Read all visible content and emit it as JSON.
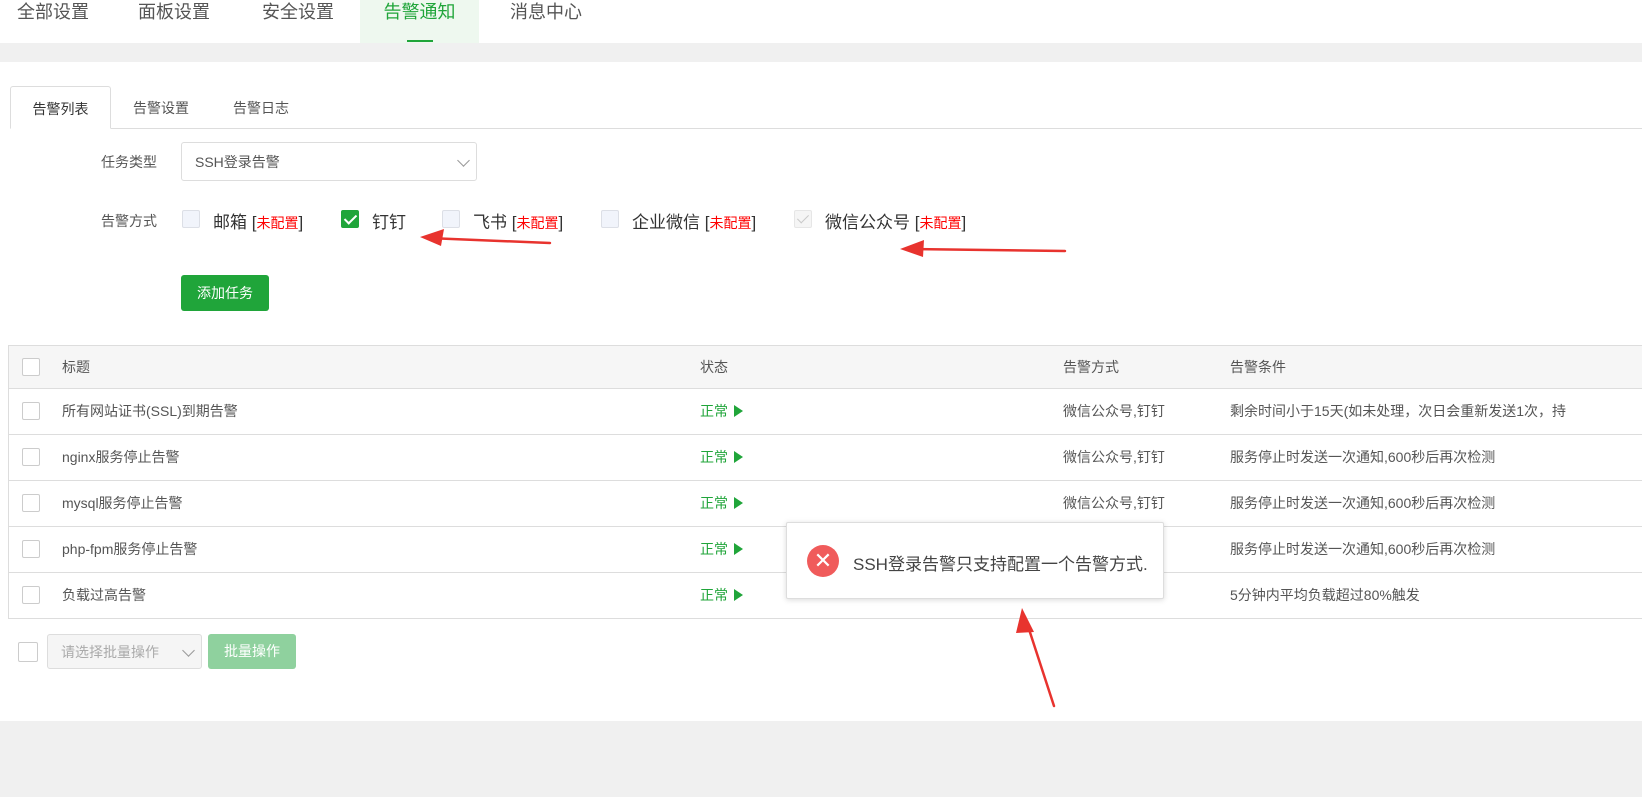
{
  "top_tabs": [
    "全部设置",
    "面板设置",
    "安全设置",
    "告警通知",
    "消息中心"
  ],
  "sub_tabs": [
    "告警列表",
    "告警设置",
    "告警日志"
  ],
  "form": {
    "task_type_label": "任务类型",
    "task_type_value": "SSH登录告警",
    "method_label": "告警方式",
    "methods": [
      {
        "name": "邮箱",
        "checked": false,
        "not_configured": "未配置"
      },
      {
        "name": "钉钉",
        "checked": true,
        "not_configured": ""
      },
      {
        "name": "飞书",
        "checked": false,
        "not_configured": "未配置"
      },
      {
        "name": "企业微信",
        "checked": false,
        "not_configured": "未配置"
      },
      {
        "name": "微信公众号",
        "checked": false,
        "disabled": true,
        "not_configured": "未配置"
      }
    ],
    "add_button": "添加任务"
  },
  "table": {
    "headers": [
      "标题",
      "状态",
      "告警方式",
      "告警条件"
    ],
    "rows": [
      {
        "title": "所有网站证书(SSL)到期告警",
        "status": "正常",
        "method": "微信公众号,钉钉",
        "condition": "剩余时间小于15天(如未处理，次日会重新发送1次，持"
      },
      {
        "title": "nginx服务停止告警",
        "status": "正常",
        "method": "微信公众号,钉钉",
        "condition": "服务停止时发送一次通知,600秒后再次检测"
      },
      {
        "title": "mysql服务停止告警",
        "status": "正常",
        "method": "微信公众号,钉钉",
        "condition": "服务停止时发送一次通知,600秒后再次检测"
      },
      {
        "title": "php-fpm服务停止告警",
        "status": "正常",
        "method": "",
        "condition": "服务停止时发送一次通知,600秒后再次检测"
      },
      {
        "title": "负载过高告警",
        "status": "正常",
        "method": "",
        "condition": "5分钟内平均负载超过80%触发"
      }
    ]
  },
  "batch": {
    "select_placeholder": "请选择批量操作",
    "button": "批量操作"
  },
  "toast": {
    "message": "SSH登录告警只支持配置一个告警方式."
  },
  "colors": {
    "accent": "#20a53a",
    "error": "#f05b5b",
    "annotation": "#e8332e"
  }
}
